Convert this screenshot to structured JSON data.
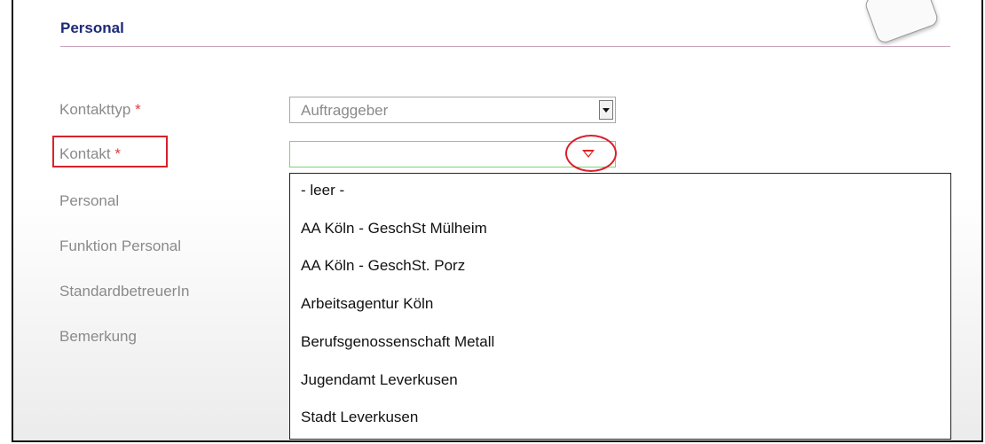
{
  "section": {
    "title": "Personal"
  },
  "form": {
    "required_marker": "*",
    "labels": {
      "kontakttyp": "Kontakttyp",
      "kontakt": "Kontakt",
      "personal": "Personal",
      "funktion_personal": "Funktion Personal",
      "standardbetreuer": "StandardbetreuerIn",
      "bemerkung": "Bemerkung"
    },
    "kontakttyp_value": "Auftraggeber",
    "kontakt_value": ""
  },
  "dropdown": {
    "options": [
      "- leer -",
      "AA Köln - GeschSt Mülheim",
      "AA Köln - GeschSt. Porz",
      "Arbeitsagentur Köln",
      "Berufsgenossenschaft Metall",
      "Jugendamt Leverkusen",
      "Stadt Leverkusen"
    ]
  },
  "colors": {
    "title": "#1e2a78",
    "required": "#e23b3b",
    "highlight": "#d8212d",
    "active_border": "#76d672"
  }
}
